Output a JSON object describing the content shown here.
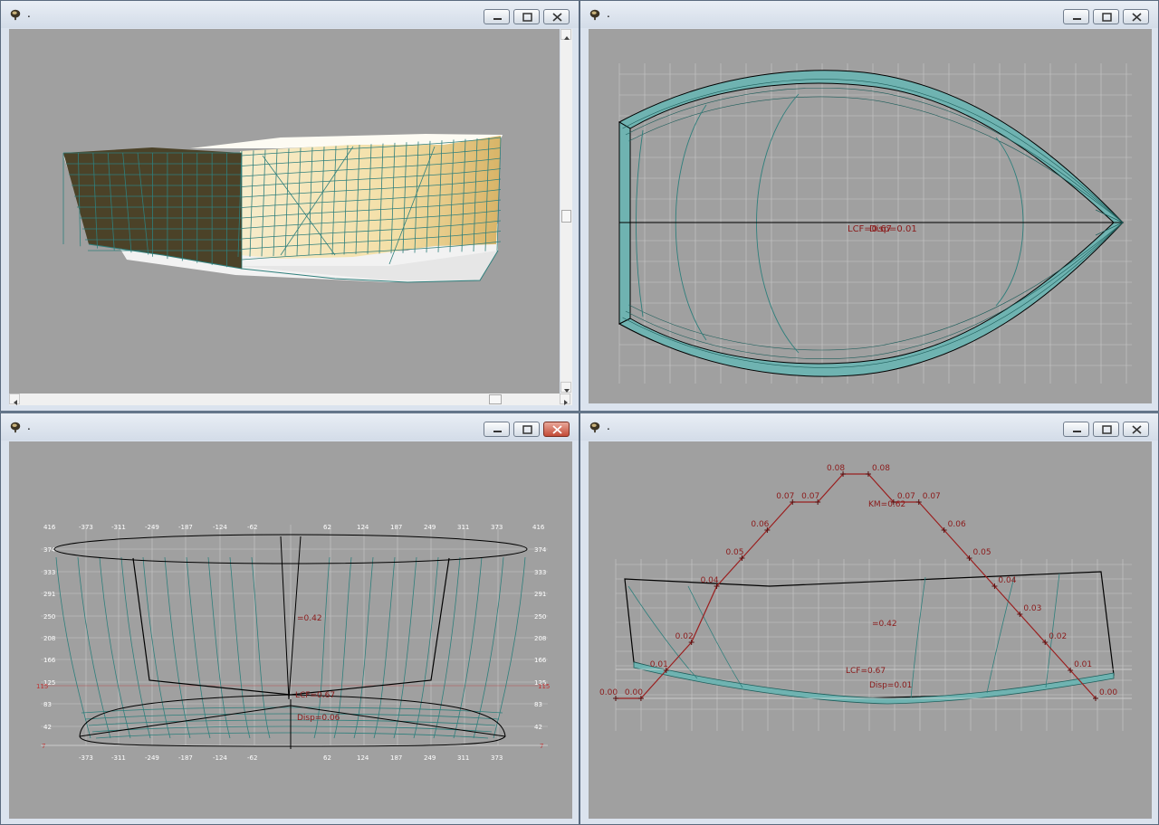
{
  "windows": {
    "perspective": {
      "title": "."
    },
    "plan": {
      "title": "."
    },
    "body": {
      "title": "."
    },
    "profile": {
      "title": "."
    }
  },
  "colors": {
    "desktop": "#6f8296",
    "client": "#a0a0a0",
    "hull_line": "#2f7f7c",
    "hull_fill": "#6fb3b1",
    "curve": "#9a1f1f",
    "outline": "#000000"
  },
  "plan_view": {
    "annotations": [
      "LCF=0.67",
      "Disp=0.01"
    ]
  },
  "body_view": {
    "x_ticks": [
      "-373",
      "-311",
      "-249",
      "-187",
      "-124",
      "-62",
      "62",
      "124",
      "187",
      "249",
      "311",
      "373"
    ],
    "x_ticks_top_outer": "416",
    "y_ticks": [
      "374",
      "333",
      "291",
      "250",
      "208",
      "166",
      "125",
      "83",
      "42"
    ],
    "y_tick_top": "416",
    "waterline_label": "115",
    "bottom_label": "7",
    "annotations": {
      "cog": "=0.42",
      "lcf": "LCF=0.67",
      "disp": "Disp=0.06"
    }
  },
  "profile_view": {
    "chart_data": {
      "type": "line",
      "series": [
        {
          "values": [
            0.0,
            0.0,
            0.01,
            0.02,
            0.04,
            0.05,
            0.06,
            0.07,
            0.07,
            0.08,
            0.08,
            0.07,
            0.07,
            0.06,
            0.05,
            0.04,
            0.03,
            0.02,
            0.01,
            0.0
          ]
        }
      ]
    },
    "annotations": {
      "km": "KM=0.62",
      "cog": "=0.42",
      "lcf": "LCF=0.67",
      "disp": "Disp=0.01"
    }
  }
}
